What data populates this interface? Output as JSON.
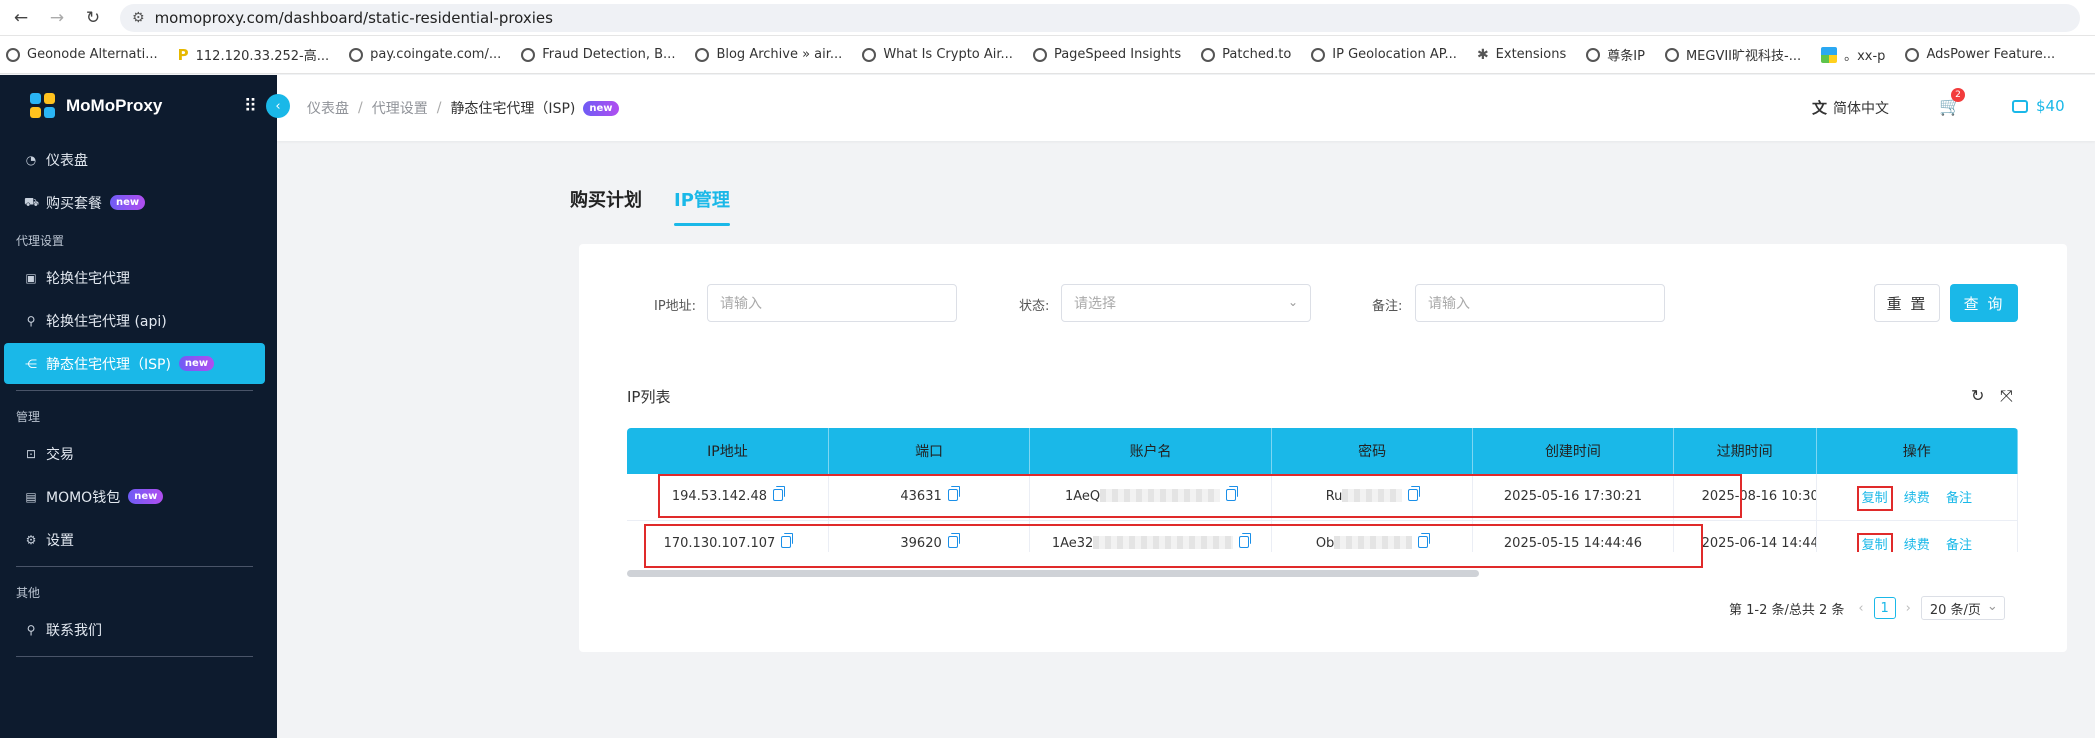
{
  "browser": {
    "url": "momoproxy.com/dashboard/static-residential-proxies",
    "bookmarks": [
      {
        "label": "Geonode Alternati...",
        "icon": "globe"
      },
      {
        "label": "112.120.33.252-高...",
        "icon": "flag"
      },
      {
        "label": "pay.coingate.com/...",
        "icon": "globe"
      },
      {
        "label": "Fraud Detection, B...",
        "icon": "globe"
      },
      {
        "label": "Blog Archive » air...",
        "icon": "globe"
      },
      {
        "label": "What Is Crypto Air...",
        "icon": "globe"
      },
      {
        "label": "PageSpeed Insights",
        "icon": "globe"
      },
      {
        "label": "Patched.to",
        "icon": "globe"
      },
      {
        "label": "IP Geolocation AP...",
        "icon": "globe"
      },
      {
        "label": "Extensions",
        "icon": "puzzle"
      },
      {
        "label": "尊条IP",
        "icon": "globe"
      },
      {
        "label": "MEGVII旷视科技-...",
        "icon": "globe"
      },
      {
        "label": "。xx-p",
        "icon": "grid"
      },
      {
        "label": "AdsPower Feature...",
        "icon": "globe"
      }
    ]
  },
  "sidebar": {
    "logo": "MoMoProxy",
    "items": [
      {
        "type": "item",
        "label": "仪表盘",
        "icon": "dashboard-icon"
      },
      {
        "type": "item",
        "label": "购买套餐",
        "icon": "cart-icon",
        "badge": "new"
      },
      {
        "type": "group",
        "label": "代理设置"
      },
      {
        "type": "item",
        "label": "轮换住宅代理",
        "icon": "proxy-icon"
      },
      {
        "type": "item",
        "label": "轮换住宅代理 (api)",
        "icon": "link-icon"
      },
      {
        "type": "item",
        "label": "静态住宅代理（ISP)",
        "icon": "share-icon",
        "badge": "new",
        "active": true
      },
      {
        "type": "divider"
      },
      {
        "type": "group",
        "label": "管理"
      },
      {
        "type": "item",
        "label": "交易",
        "icon": "transaction-icon"
      },
      {
        "type": "item",
        "label": "MOMO钱包",
        "icon": "wallet-icon",
        "badge": "new"
      },
      {
        "type": "item",
        "label": "设置",
        "icon": "gear-icon"
      },
      {
        "type": "divider"
      },
      {
        "type": "group",
        "label": "其他"
      },
      {
        "type": "item",
        "label": "联系我们",
        "icon": "link-icon"
      },
      {
        "type": "divider"
      }
    ]
  },
  "header": {
    "breadcrumbs": [
      "仪表盘",
      "代理设置",
      "静态住宅代理（ISP)"
    ],
    "breadcrumb_badge": "new",
    "language": "简体中文",
    "cart_count": "2",
    "balance": "$40"
  },
  "tabs": [
    {
      "label": "购买计划",
      "active": false
    },
    {
      "label": "IP管理",
      "active": true
    }
  ],
  "filters": {
    "ip_label": "IP地址:",
    "ip_placeholder": "请输入",
    "status_label": "状态:",
    "status_placeholder": "请选择",
    "note_label": "备注:",
    "note_placeholder": "请输入",
    "reset": "重 置",
    "query": "查 询"
  },
  "ip_list": {
    "title": "IP列表",
    "columns": [
      "IP地址",
      "端口",
      "账户名",
      "密码",
      "创建时间",
      "过期时间",
      "操作"
    ],
    "rows": [
      {
        "ip": "194.53.142.48",
        "port": "43631",
        "account": "1AeQ",
        "password": "Ru",
        "created": "2025-05-16 17:30:21",
        "expires": "2025-08-16 10:30",
        "actions": [
          "复制",
          "续费",
          "备注"
        ]
      },
      {
        "ip": "170.130.107.107",
        "port": "39620",
        "account": "1Ae32",
        "password": "Ob",
        "created": "2025-05-15 14:44:46",
        "expires": "2025-06-14 14:44",
        "actions": [
          "复制",
          "续费",
          "备注"
        ]
      }
    ]
  },
  "pagination": {
    "summary": "第 1-2 条/总共 2 条",
    "current_page": "1",
    "page_size": "20 条/页"
  },
  "colors": {
    "accent": "#1ab8e8",
    "sidebar_bg": "#0d1b2e",
    "highlight": "#e02a2a"
  }
}
